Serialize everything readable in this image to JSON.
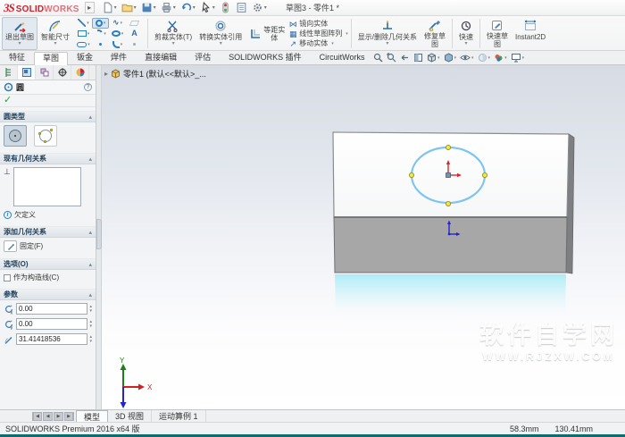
{
  "colors": {
    "brand_red": "#d1202c",
    "accent_blue": "#2a7fc1",
    "sketch_circle": "#7cc4f2",
    "quadrant_yellow": "#f3e93c",
    "box_gray": "#a7a7a7",
    "reflection_cyan": "#abecf7",
    "statusbar_teal": "#0d6b74"
  },
  "icons": {
    "dropdown": "▾",
    "flyout_right": "▸",
    "spinner_up": "▴",
    "spinner_down": "▾",
    "perpendicular": "⊥",
    "check": "✓",
    "help": "?",
    "info": "i",
    "text_tool": "A",
    "spline": "∿",
    "mirror": "⋈",
    "pattern": "▦",
    "move": "↗",
    "nav_prev": "◀",
    "nav_next": "▶"
  },
  "title_bar": {
    "logo_mark": "3S",
    "logo_brand_bold": "SOLID",
    "logo_brand_light": "WORKS",
    "title": "草图3 - 零件1 *"
  },
  "ribbon": {
    "exit_sketch": "退出草图",
    "smart_dimension": "智能尺寸",
    "trim": "剪裁实体(T)",
    "convert": "转换实体引用",
    "offset_l1": "等距实",
    "offset_l2": "体",
    "mirror": "镜向实体",
    "linear_pattern": "线性草图阵列",
    "move": "移动实体",
    "display_delete_relations": "显示/删除几何关系",
    "repair_l1": "修复草",
    "repair_l2": "图",
    "quick_snaps": "快速",
    "rapid_l1": "快速草",
    "rapid_l2": "图",
    "instant2d": "Instant2D"
  },
  "command_tabs": {
    "items": [
      {
        "label": "特征"
      },
      {
        "label": "草图"
      },
      {
        "label": "钣金"
      },
      {
        "label": "焊件"
      },
      {
        "label": "直接编辑"
      },
      {
        "label": "评估"
      },
      {
        "label": "SOLIDWORKS 插件"
      },
      {
        "label": "CircuitWorks"
      }
    ],
    "active_label": "草图"
  },
  "property_manager": {
    "title": "圆",
    "circle_type": {
      "title": "圆类型"
    },
    "existing_relations": {
      "title": "现有几何关系",
      "status_label": "欠定义"
    },
    "add_relations": {
      "title": "添加几何关系",
      "fix_label": "固定(F)"
    },
    "options": {
      "title": "选项(O)",
      "construction_label": "作为构造线(C)"
    },
    "parameters": {
      "title": "参数",
      "x_value": "0.00",
      "y_value": "0.00",
      "radius_value": "31.41418536"
    }
  },
  "viewport": {
    "feature_tree_item": "零件1 (默认<<默认>_...",
    "watermark": {
      "line1": "软件自学网",
      "line2": "WWW.RJZXW.COM"
    },
    "triad": {
      "x_label": "X",
      "y_label": "Y"
    }
  },
  "document_tabs": {
    "items": [
      {
        "label": "模型"
      },
      {
        "label": "3D 视图"
      },
      {
        "label": "运动算例 1"
      }
    ],
    "active_label": "模型"
  },
  "status_bar": {
    "app_version": "SOLIDWORKS Premium 2016 x64 版",
    "coord_x": "58.3mm",
    "coord_y": "130.41mm"
  }
}
